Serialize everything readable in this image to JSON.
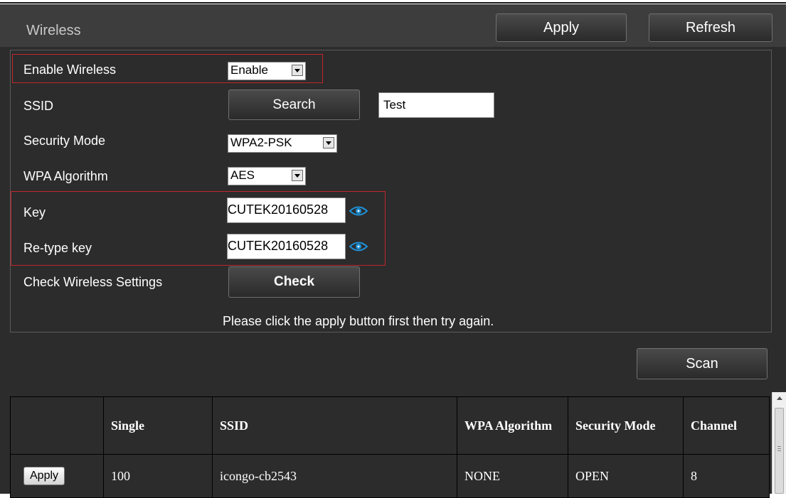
{
  "header": {
    "title": "Wireless",
    "apply_label": "Apply",
    "refresh_label": "Refresh"
  },
  "settings": {
    "enable_wireless": {
      "label": "Enable Wireless",
      "value": "Enable"
    },
    "ssid": {
      "label": "SSID",
      "search_label": "Search",
      "value": "Test"
    },
    "security_mode": {
      "label": "Security Mode",
      "value": "WPA2-PSK"
    },
    "wpa_algorithm": {
      "label": "WPA Algorithm",
      "value": "AES"
    },
    "key": {
      "label": "Key",
      "value": "CUTEK20160528",
      "icon": "eye-icon"
    },
    "retype_key": {
      "label": "Re-type key",
      "value": "CUTEK20160528",
      "icon": "eye-icon"
    },
    "check": {
      "label": "Check Wireless Settings",
      "button_label": "Check"
    },
    "message": "Please click the apply button first then try again."
  },
  "highlight_color": "#c0262c",
  "accent_icon_color": "#1e90d6",
  "scan": {
    "button_label": "Scan",
    "columns": [
      "",
      "Single",
      "SSID",
      "WPA Algorithm",
      "Security Mode",
      "Channel"
    ],
    "rows": [
      {
        "action_label": "Apply",
        "single": "100",
        "ssid": "icongo-cb2543",
        "wpa_algorithm": "NONE",
        "security_mode": "OPEN",
        "channel": "8"
      }
    ]
  }
}
